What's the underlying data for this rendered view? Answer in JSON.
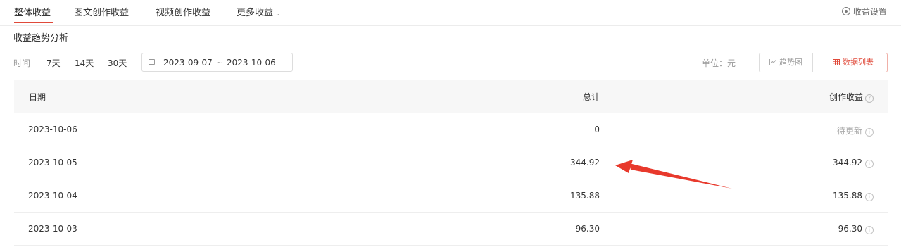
{
  "tabs": [
    {
      "label": "整体收益"
    },
    {
      "label": "图文创作收益"
    },
    {
      "label": "视频创作收益"
    },
    {
      "label": "更多收益"
    }
  ],
  "more_arrow": "⌄",
  "settings": {
    "label": "收益设置"
  },
  "section_title": "收益趋势分析",
  "filter": {
    "label": "时间",
    "ranges": [
      "7天",
      "14天",
      "30天"
    ],
    "start_date": "2023-09-07",
    "separator": "~",
    "end_date": "2023-10-06",
    "unit": "单位：元"
  },
  "view_toggle": {
    "chart": "趋势图",
    "list": "数据列表"
  },
  "table": {
    "headers": {
      "date": "日期",
      "total": "总计",
      "creation": "创作收益"
    },
    "rows": [
      {
        "date": "2023-10-06",
        "total": "0",
        "creation": "待更新"
      },
      {
        "date": "2023-10-05",
        "total": "344.92",
        "creation": "344.92"
      },
      {
        "date": "2023-10-04",
        "total": "135.88",
        "creation": "135.88"
      },
      {
        "date": "2023-10-03",
        "total": "96.30",
        "creation": "96.30"
      }
    ]
  },
  "colors": {
    "accent": "#e04a3a",
    "annotation_arrow": "#e8392c"
  }
}
